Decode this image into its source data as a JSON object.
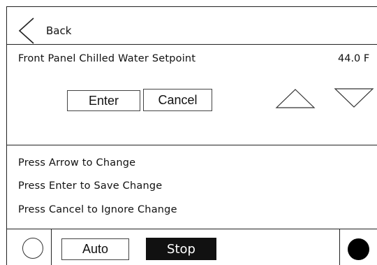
{
  "header": {
    "back_label": "Back"
  },
  "setpoint": {
    "label": "Front Panel Chilled Water Setpoint",
    "value": "44.0 F"
  },
  "actions": {
    "enter_label": "Enter",
    "cancel_label": "Cancel"
  },
  "instructions": [
    "Press Arrow to Change",
    "Press Enter to Save Change",
    "Press Cancel to Ignore Change"
  ],
  "footer": {
    "auto_label": "Auto",
    "stop_label": "Stop"
  },
  "icons": {
    "back": "chevron-left-icon",
    "up": "triangle-up-icon",
    "down": "triangle-down-icon",
    "left_indicator": "hollow-circle-icon",
    "right_indicator": "filled-circle-icon"
  }
}
